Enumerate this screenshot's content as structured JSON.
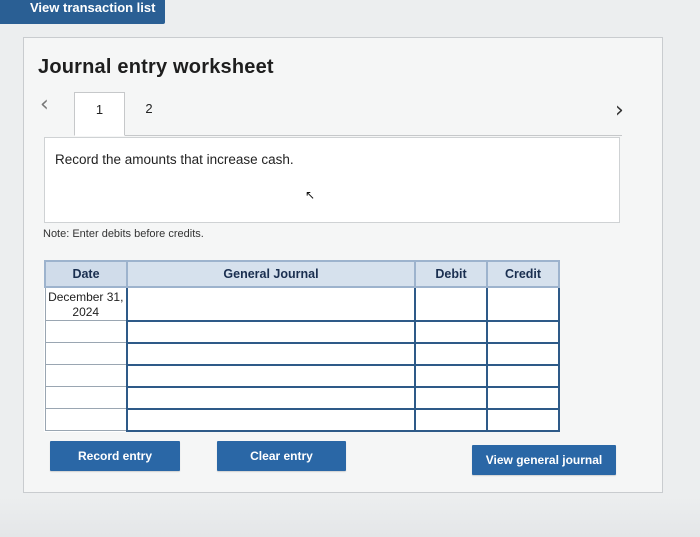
{
  "header": {
    "view_transactions_label": "View transaction list"
  },
  "worksheet": {
    "title": "Journal entry worksheet",
    "tabs": [
      {
        "label": "1",
        "active": true
      },
      {
        "label": "2",
        "active": false
      }
    ],
    "prev_icon": "chevron-left-icon",
    "next_icon": "chevron-right-icon",
    "instruction": "Record the amounts that increase cash.",
    "note": "Note: Enter debits before credits."
  },
  "table": {
    "headers": {
      "date": "Date",
      "journal": "General Journal",
      "debit": "Debit",
      "credit": "Credit"
    },
    "rows": [
      {
        "date": "December 31, 2024",
        "account": "",
        "debit": "",
        "credit": ""
      },
      {
        "date": "",
        "account": "",
        "debit": "",
        "credit": ""
      },
      {
        "date": "",
        "account": "",
        "debit": "",
        "credit": ""
      },
      {
        "date": "",
        "account": "",
        "debit": "",
        "credit": ""
      },
      {
        "date": "",
        "account": "",
        "debit": "",
        "credit": ""
      },
      {
        "date": "",
        "account": "",
        "debit": "",
        "credit": ""
      }
    ]
  },
  "buttons": {
    "record": "Record entry",
    "clear": "Clear entry",
    "view_journal": "View general journal"
  },
  "colors": {
    "button_bg": "#2a67a6",
    "header_bg": "#d6e1ed",
    "cell_border": "#2e5a88"
  }
}
